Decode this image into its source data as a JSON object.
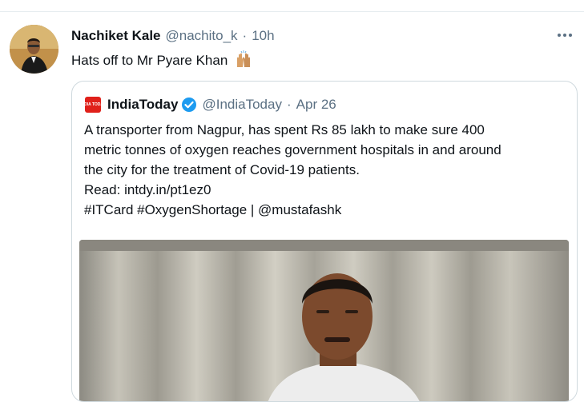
{
  "tweet": {
    "author_name": "Nachiket Kale",
    "handle": "@nachito_k",
    "separator": "·",
    "time": "10h",
    "text": "Hats off to Mr Pyare Khan",
    "emoji": "raising-hands-emoji"
  },
  "quoted_tweet": {
    "logo_text": "INDIA TODAY",
    "author_name": "IndiaToday",
    "verified": true,
    "handle": "@IndiaToday",
    "separator": "·",
    "time": "Apr 26",
    "lines": [
      "A transporter from Nagpur, has spent Rs 85 lakh to make sure 400",
      "metric tonnes of oxygen reaches government hospitals in and around",
      "the city for the treatment of Covid-19 patients.",
      "Read: intdy.in/pt1ez0",
      "#ITCard #OxygenShortage | @mustafashk"
    ]
  },
  "colors": {
    "text": "#0f1419",
    "secondary": "#5b7083",
    "border": "#cfd9de",
    "verified": "#1d9bf0",
    "logo": "#e0201a"
  }
}
